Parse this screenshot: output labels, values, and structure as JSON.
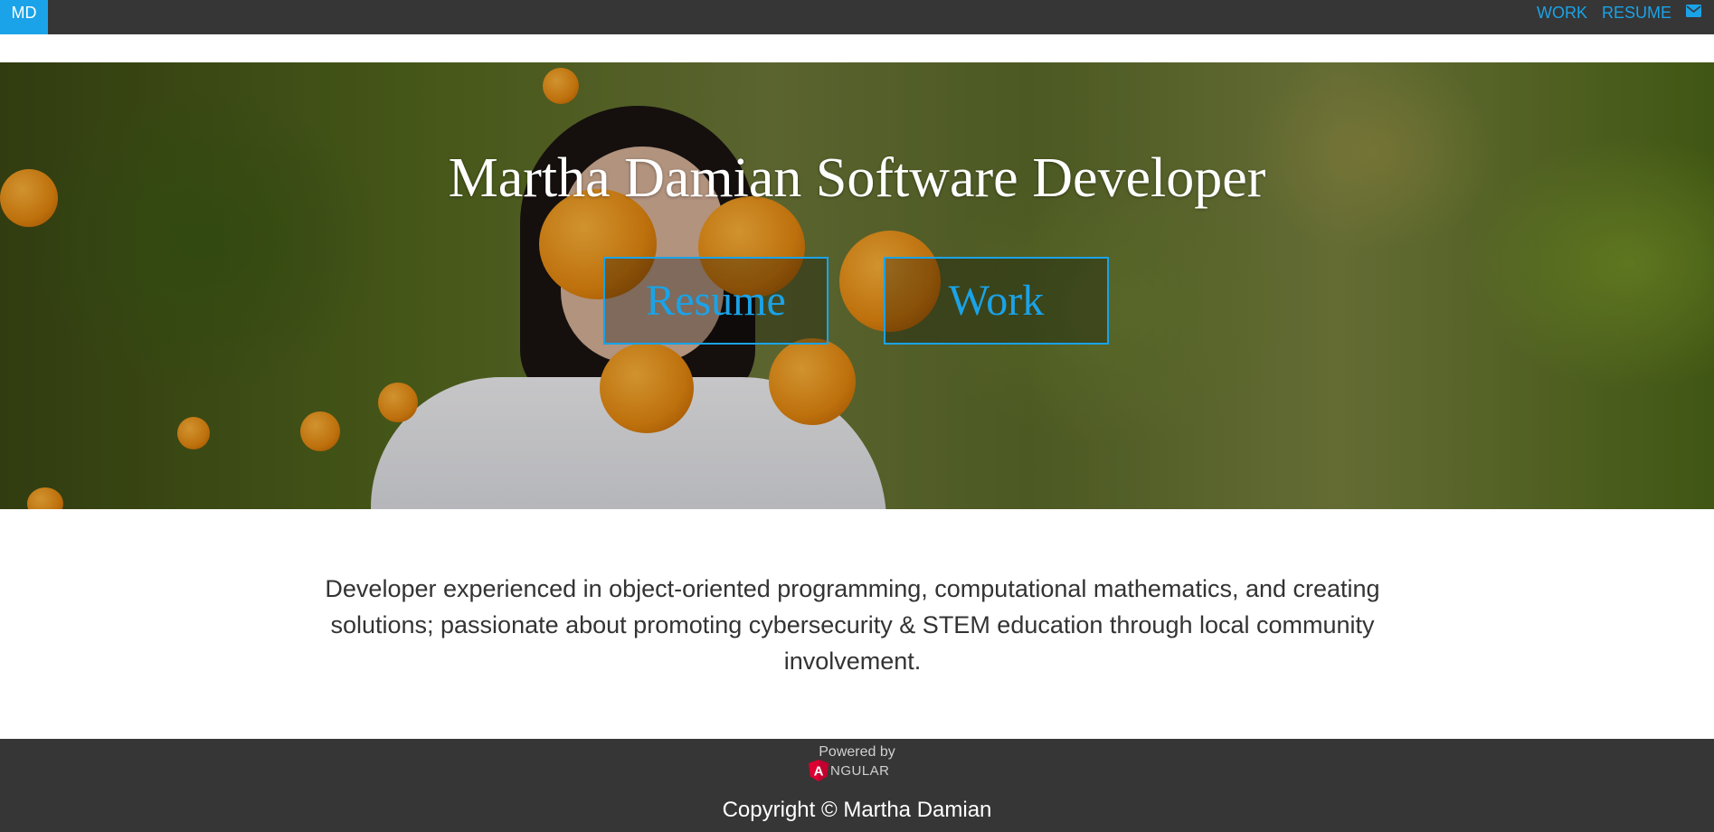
{
  "navbar": {
    "brand": "MD",
    "links": [
      {
        "label": "WORK"
      },
      {
        "label": "RESUME"
      }
    ],
    "mail_icon": "envelope-icon"
  },
  "hero": {
    "title": "Martha Damian Software Developer",
    "buttons": [
      {
        "label": "Resume"
      },
      {
        "label": "Work"
      }
    ]
  },
  "about": {
    "text": "Developer experienced in object-oriented programming, computational mathematics, and creating solutions; passionate about promoting cybersecurity & STEM education through local community involvement."
  },
  "footer": {
    "powered_by": "Powered by",
    "logo_word": "NGULAR",
    "logo_letter": "A",
    "copyright": "Copyright © Martha Damian"
  },
  "colors": {
    "accent": "#1aa3e8",
    "navbar_bg": "#363636",
    "angular_red": "#dd0031"
  }
}
